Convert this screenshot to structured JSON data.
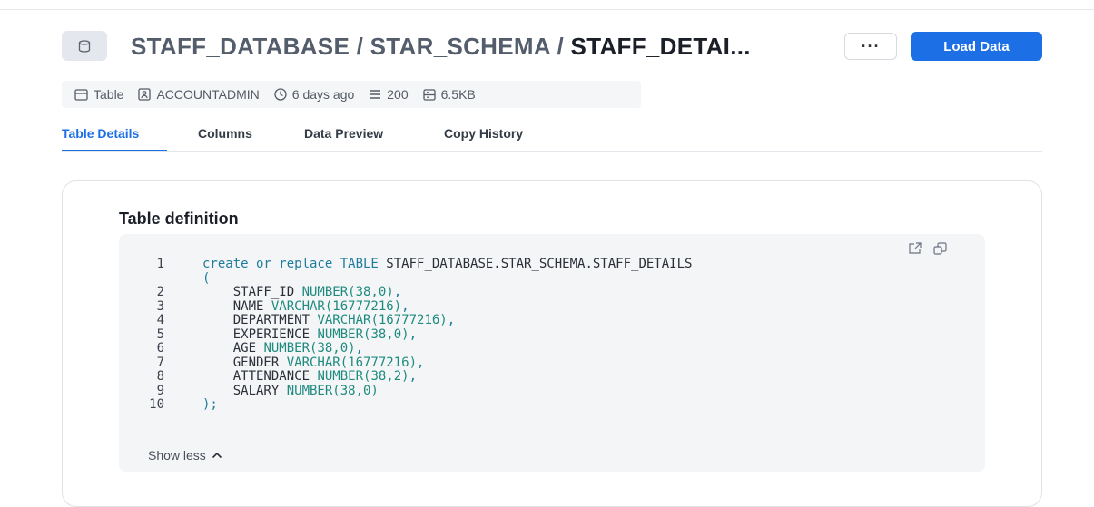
{
  "header": {
    "path_prefix": "STAFF_DATABASE / STAR_SCHEMA / ",
    "current": "STAFF_DETAI...",
    "more_label": "···",
    "load_label": "Load Data",
    "badge_icon": "database-icon"
  },
  "meta": {
    "type": "Table",
    "owner": "ACCOUNTADMIN",
    "modified": "6 days ago",
    "rows": "200",
    "size": "6.5KB"
  },
  "tabs": [
    {
      "label": "Table Details",
      "active": true
    },
    {
      "label": "Columns",
      "active": false
    },
    {
      "label": "Data Preview",
      "active": false
    },
    {
      "label": "Copy History",
      "active": false
    }
  ],
  "definition": {
    "title": "Table definition",
    "show_less": "Show less",
    "lines": [
      {
        "n": "1",
        "parts": [
          [
            "kw",
            "create or replace TABLE "
          ],
          [
            "",
            "STAFF_DATABASE.STAR_SCHEMA.STAFF_DETAILS"
          ]
        ]
      },
      {
        "n": "",
        "parts": [
          [
            "kw",
            "("
          ]
        ]
      },
      {
        "n": "2",
        "parts": [
          [
            "",
            "    STAFF_ID "
          ],
          [
            "ty",
            "NUMBER(38,0)"
          ],
          [
            "kw",
            ","
          ]
        ]
      },
      {
        "n": "3",
        "parts": [
          [
            "",
            "    NAME "
          ],
          [
            "ty",
            "VARCHAR(16777216)"
          ],
          [
            "kw",
            ","
          ]
        ]
      },
      {
        "n": "4",
        "parts": [
          [
            "",
            "    DEPARTMENT "
          ],
          [
            "ty",
            "VARCHAR(16777216)"
          ],
          [
            "kw",
            ","
          ]
        ]
      },
      {
        "n": "5",
        "parts": [
          [
            "",
            "    EXPERIENCE "
          ],
          [
            "ty",
            "NUMBER(38,0)"
          ],
          [
            "kw",
            ","
          ]
        ]
      },
      {
        "n": "6",
        "parts": [
          [
            "",
            "    AGE "
          ],
          [
            "ty",
            "NUMBER(38,0)"
          ],
          [
            "kw",
            ","
          ]
        ]
      },
      {
        "n": "7",
        "parts": [
          [
            "",
            "    GENDER "
          ],
          [
            "ty",
            "VARCHAR(16777216)"
          ],
          [
            "kw",
            ","
          ]
        ]
      },
      {
        "n": "8",
        "parts": [
          [
            "",
            "    ATTENDANCE "
          ],
          [
            "ty",
            "NUMBER(38,2)"
          ],
          [
            "kw",
            ","
          ]
        ]
      },
      {
        "n": "9",
        "parts": [
          [
            "",
            "    SALARY "
          ],
          [
            "ty",
            "NUMBER(38,0)"
          ]
        ]
      },
      {
        "n": "10",
        "parts": [
          [
            "kw",
            ");"
          ]
        ]
      }
    ]
  }
}
